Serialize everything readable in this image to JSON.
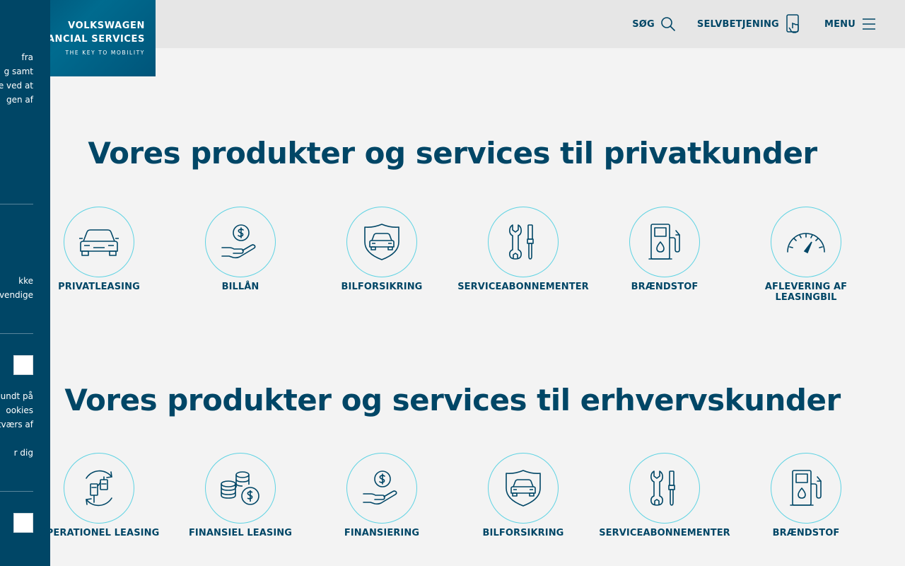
{
  "header": {
    "logo": {
      "line1": "VOLKSWAGEN",
      "line2": "FINANCIAL SERVICES",
      "tagline": "THE KEY TO MOBILITY"
    },
    "nav": [
      {
        "label": "SØG",
        "icon": "search-icon"
      },
      {
        "label": "SELVBETJENING",
        "icon": "phone-tap-icon"
      },
      {
        "label": "MENU",
        "icon": "hamburger-icon"
      }
    ]
  },
  "cookie_panel": {
    "text_block_1": [
      "fra",
      "g samt",
      "e ved at",
      "gen af"
    ],
    "text_block_2": [
      "kke",
      "vendige"
    ],
    "text_block_3": [
      "undt på",
      "ookies",
      "tværs af",
      "",
      "r dig"
    ]
  },
  "private": {
    "title": "Vores produkter og services til privatkunder",
    "items": [
      {
        "label": "PRIVATLEASING",
        "icon": "car-icon"
      },
      {
        "label": "BILLÅN",
        "icon": "hand-coin-icon"
      },
      {
        "label": "BILFORSIKRING",
        "icon": "car-shield-icon"
      },
      {
        "label": "SERVICEABONNEMENTER",
        "icon": "wrench-screwdriver-icon"
      },
      {
        "label": "BRÆNDSTOF",
        "icon": "fuel-pump-icon"
      },
      {
        "label": "AFLEVERING AF LEASINGBIL",
        "icon": "speedometer-icon"
      }
    ]
  },
  "business": {
    "title": "Vores produkter og services til erhvervskunder",
    "items": [
      {
        "label": "OPERATIONEL LEASING",
        "icon": "key-cycle-icon"
      },
      {
        "label": "FINANSIEL LEASING",
        "icon": "coin-stack-icon"
      },
      {
        "label": "FINANSIERING",
        "icon": "hand-coin-icon"
      },
      {
        "label": "BILFORSIKRING",
        "icon": "car-shield-icon"
      },
      {
        "label": "SERVICEABONNEMENTER",
        "icon": "wrench-screwdriver-icon"
      },
      {
        "label": "BRÆNDSTOF",
        "icon": "fuel-pump-icon"
      }
    ]
  },
  "colors": {
    "brand_dark": "#004666",
    "accent_circle": "#5fd3e3",
    "topbar_bg": "#e6e6e6",
    "page_bg": "#f3f3f3"
  }
}
